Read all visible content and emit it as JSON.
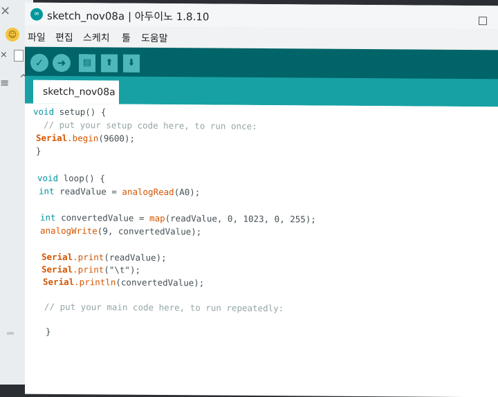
{
  "window": {
    "title": "sketch_nov08a | 아두이노 1.8.10",
    "logo_label": "∞"
  },
  "menu": [
    "파일",
    "편집",
    "스케치",
    "툴",
    "도움말"
  ],
  "toolbar": {
    "verify": "✓",
    "upload": "➜",
    "new": "▤",
    "open": "⬆",
    "save": "⬇"
  },
  "tab": {
    "label": "sketch_nov08a"
  },
  "code": {
    "line1a": "void",
    "line1b": " setup",
    "line1c": "() {",
    "line2": "  // put your setup code here, to run once:",
    "line3a": "Serial",
    "line3b": ".begin",
    "line3c": "(9600);",
    "line4": "}",
    "line6a": "void",
    "line6b": " loop",
    "line6c": "() {",
    "line7a": "int",
    "line7b": " readValue = ",
    "line7c": "analogRead",
    "line7d": "(A0);",
    "line9a": "int",
    "line9b": " convertedValue = ",
    "line9c": "map",
    "line9d": "(readValue, 0, 1023, 0, 255);",
    "line10a": "analogWrite",
    "line10b": "(9, convertedValue);",
    "line12a": "Serial",
    "line12b": ".print",
    "line12c": "(readValue);",
    "line13a": "Serial",
    "line13b": ".print",
    "line13c": "(\"\\t\");",
    "line14a": "Serial",
    "line14b": ".println",
    "line14c": "(convertedValue);",
    "line16": "// put your main code here, to run repeatedly:",
    "line18": "}"
  }
}
